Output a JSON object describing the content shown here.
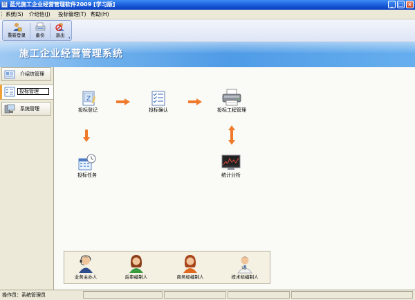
{
  "window": {
    "title": "蓝光施工企业经营管理软件2009 [学习版]"
  },
  "menu": [
    {
      "label": "系统(S)"
    },
    {
      "label": "介绍信(J)"
    },
    {
      "label": "投标管理(T)"
    },
    {
      "label": "帮助(H)"
    }
  ],
  "toolbar": {
    "relogin_label": "重新登录",
    "backup_label": "备份",
    "exit_label": "退出"
  },
  "banner": {
    "title": "施工企业经营管理系统"
  },
  "sidebar": {
    "items": [
      {
        "label": "介绍信管理",
        "icon": "document-icon"
      },
      {
        "label": "投标管理",
        "icon": "checklist-icon",
        "active": true
      },
      {
        "label": "系统管理",
        "icon": "computer-icon"
      }
    ]
  },
  "workflow": {
    "nodes": [
      {
        "label": "投标登记",
        "icon": "register-icon"
      },
      {
        "label": "投标确认",
        "icon": "checklist-icon"
      },
      {
        "label": "投标工程管理",
        "icon": "printer-icon"
      },
      {
        "label": "投标任务",
        "icon": "calendar-icon"
      },
      {
        "label": "统计分析",
        "icon": "chart-monitor-icon"
      }
    ]
  },
  "roles": [
    {
      "label": "业务主办人",
      "icon": "operator-headset-icon"
    },
    {
      "label": "后审编制人",
      "icon": "woman-avatar-icon"
    },
    {
      "label": "商务标编制人",
      "icon": "woman-orange-avatar-icon"
    },
    {
      "label": "技术标编制人",
      "icon": "doctor-avatar-icon"
    }
  ],
  "status": {
    "text": "操作员：系统管理员"
  },
  "colors": {
    "accent_arrow": "#f07a2a",
    "banner": "#4f9be6",
    "title_bar": "#1758d6"
  }
}
